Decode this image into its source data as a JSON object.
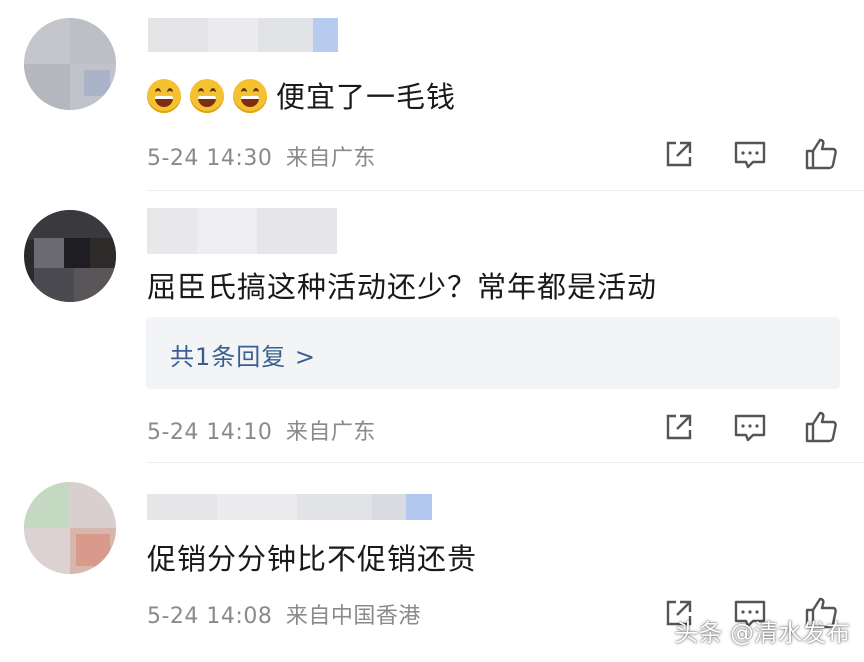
{
  "comments": [
    {
      "text": "便宜了一毛钱",
      "emoji_count": 3,
      "emoji": "laughing-face-icon",
      "time": "5-24 14:30",
      "location": "来自广东"
    },
    {
      "text": "屈臣氏搞这种活动还少？常年都是活动",
      "time": "5-24 14:10",
      "location": "来自广东",
      "reply_link": "共1条回复 >"
    },
    {
      "text": "促销分分钟比不促销还贵",
      "time": "5-24 14:08",
      "location": "来自中国香港"
    }
  ],
  "actions": [
    "share-icon",
    "comment-icon",
    "like-icon"
  ],
  "watermark": "头条 @清水发布",
  "colors": {
    "text": "#1a1a1a",
    "meta": "#8a8a8a",
    "link": "#3a5f8f",
    "reply_bg": "#f3f4f6",
    "icon": "#555555"
  }
}
